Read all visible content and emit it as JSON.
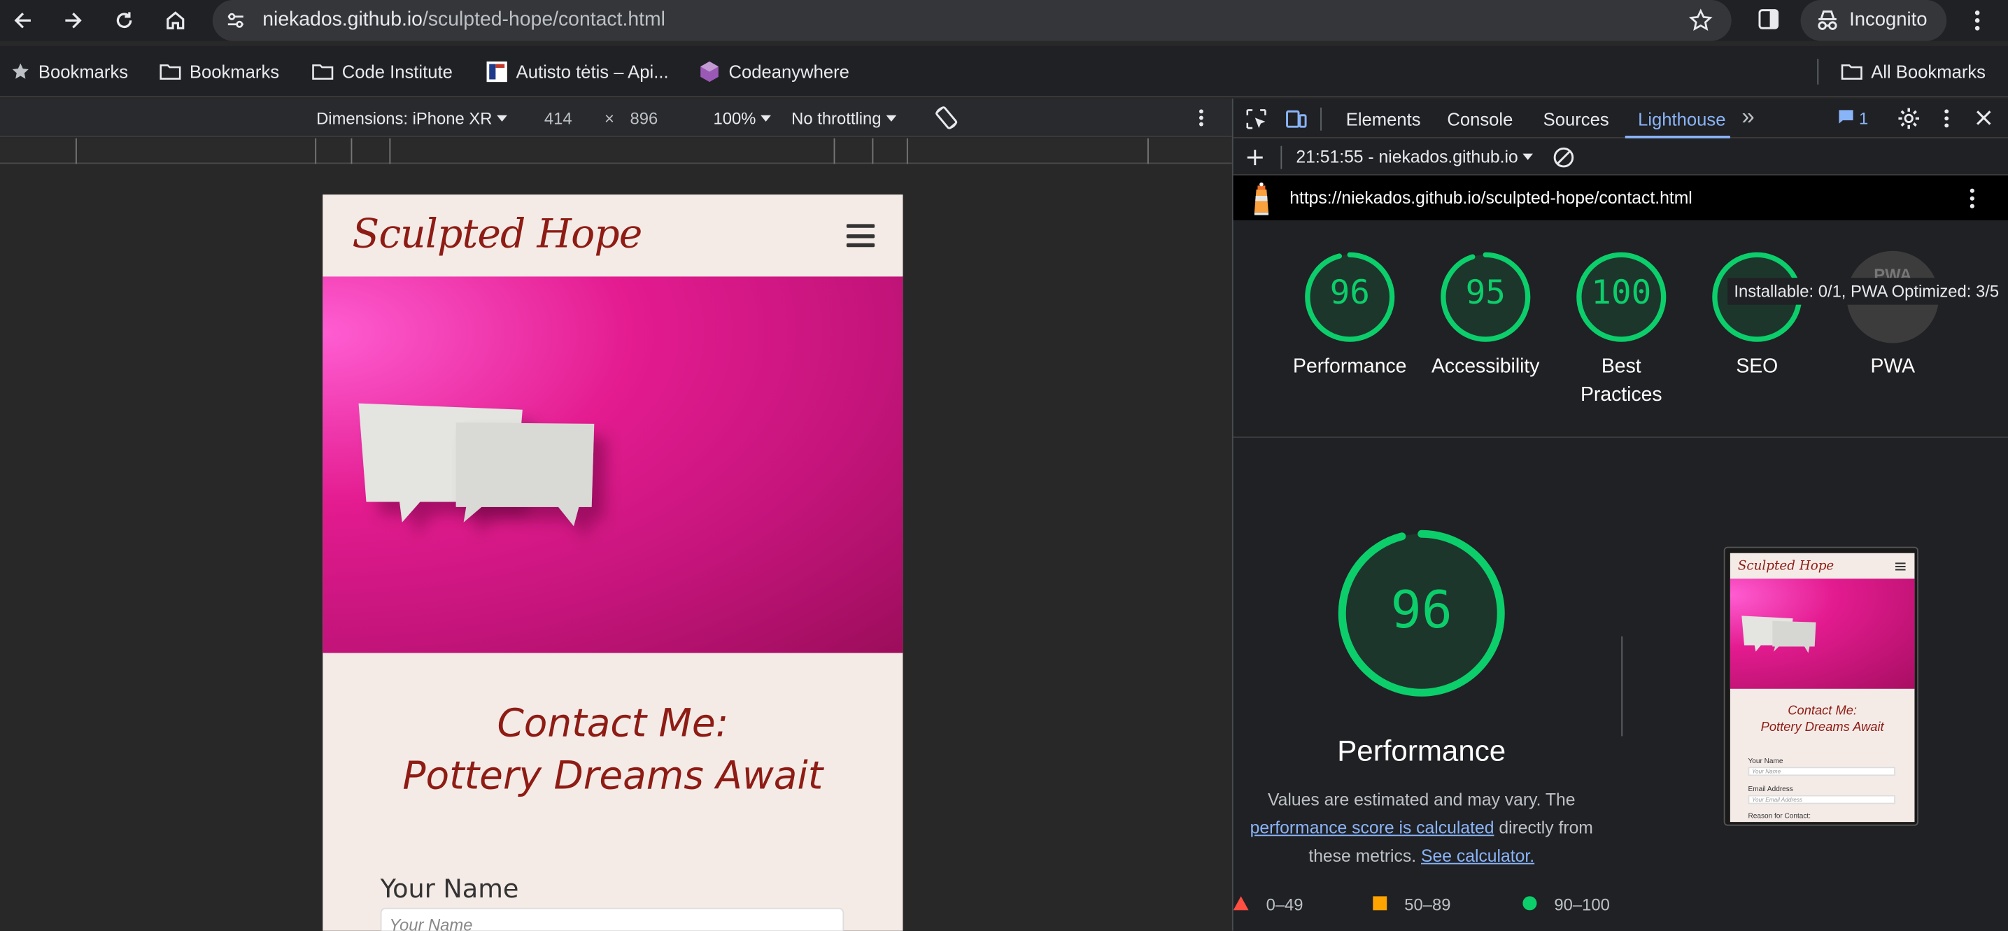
{
  "browser": {
    "url_host": "niekados.github.io",
    "url_path": "/sculpted-hope/contact.html",
    "incognito_label": "Incognito"
  },
  "bookmarks": {
    "items": [
      "Bookmarks",
      "Bookmarks",
      "Code Institute",
      "Autisto tėtis – Api...",
      "Codeanywhere"
    ],
    "all_label": "All Bookmarks"
  },
  "device_toolbar": {
    "dimensions": "Dimensions: iPhone XR",
    "width": "414",
    "times": "×",
    "height": "896",
    "zoom": "100%",
    "throttling": "No throttling"
  },
  "site": {
    "logo": "Sculpted Hope",
    "heading_line1": "Contact Me:",
    "heading_line2": "Pottery Dreams Await",
    "name_label": "Your Name",
    "name_placeholder": "Your Name"
  },
  "devtools": {
    "tabs": [
      "Elements",
      "Console",
      "Sources",
      "Lighthouse"
    ],
    "active_tab": "Lighthouse",
    "more_tabs": "»",
    "issues_count": "1",
    "report_select": "21:51:55 - niekados.github.io",
    "report_url": "https://niekados.github.io/sculpted-hope/contact.html",
    "tooltip": "Installable: 0/1, PWA Optimized: 3/5",
    "gauges": [
      {
        "score": "96",
        "label": "Performance",
        "value": 96
      },
      {
        "score": "95",
        "label": "Accessibility",
        "value": 95
      },
      {
        "score": "100",
        "label": "Best Practices",
        "value": 100
      },
      {
        "score": "",
        "label": "SEO",
        "value": 100
      },
      {
        "score": "PWA",
        "label": "PWA",
        "value": null
      }
    ],
    "performance": {
      "score": "96",
      "value": 96,
      "title": "Performance",
      "desc_1": "Values are estimated and may vary. The",
      "desc_link": "performance score is calculated",
      "desc_2": "directly from these metrics.",
      "calc_link": "See calculator."
    },
    "legend": [
      "0–49",
      "50–89",
      "90–100"
    ],
    "thumbnail": {
      "logo": "Sculpted Hope",
      "line1": "Contact Me:",
      "line2": "Pottery Dreams Await",
      "f1": "Your Name",
      "p1": "Your Name",
      "f2": "Email Address",
      "p2": "Your Email Address",
      "f3": "Reason for Contact:"
    }
  },
  "colors": {
    "gauge_green": "#0cce6b",
    "brand_red": "#8e1c14",
    "hero_magenta": "#e31b8f",
    "link_blue": "#8ab4f8"
  }
}
